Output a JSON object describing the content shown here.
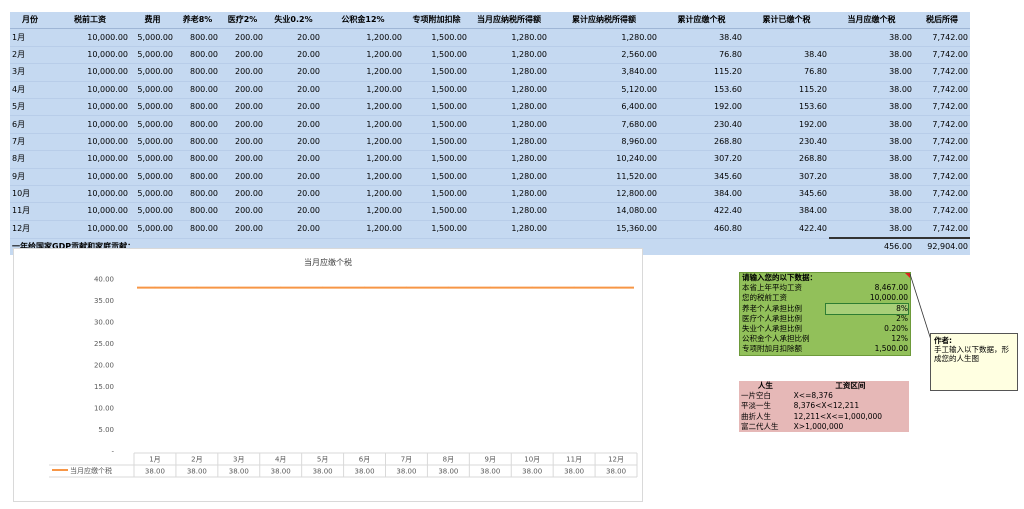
{
  "salary_table": {
    "headers": [
      "月份",
      "税前工资",
      "费用",
      "养老8%",
      "医疗2%",
      "失业0.2%",
      "公积金12%",
      "专项附加扣除",
      "当月应纳税所得额",
      "累计应纳税所得额",
      "累计应缴个税",
      "累计已缴个税",
      "当月应缴个税",
      "税后所得"
    ],
    "rows": [
      [
        "1月",
        "10,000.00",
        "5,000.00",
        "800.00",
        "200.00",
        "20.00",
        "1,200.00",
        "1,500.00",
        "1,280.00",
        "1,280.00",
        "38.40",
        "",
        "38.00",
        "7,742.00"
      ],
      [
        "2月",
        "10,000.00",
        "5,000.00",
        "800.00",
        "200.00",
        "20.00",
        "1,200.00",
        "1,500.00",
        "1,280.00",
        "2,560.00",
        "76.80",
        "38.40",
        "38.00",
        "7,742.00"
      ],
      [
        "3月",
        "10,000.00",
        "5,000.00",
        "800.00",
        "200.00",
        "20.00",
        "1,200.00",
        "1,500.00",
        "1,280.00",
        "3,840.00",
        "115.20",
        "76.80",
        "38.00",
        "7,742.00"
      ],
      [
        "4月",
        "10,000.00",
        "5,000.00",
        "800.00",
        "200.00",
        "20.00",
        "1,200.00",
        "1,500.00",
        "1,280.00",
        "5,120.00",
        "153.60",
        "115.20",
        "38.00",
        "7,742.00"
      ],
      [
        "5月",
        "10,000.00",
        "5,000.00",
        "800.00",
        "200.00",
        "20.00",
        "1,200.00",
        "1,500.00",
        "1,280.00",
        "6,400.00",
        "192.00",
        "153.60",
        "38.00",
        "7,742.00"
      ],
      [
        "6月",
        "10,000.00",
        "5,000.00",
        "800.00",
        "200.00",
        "20.00",
        "1,200.00",
        "1,500.00",
        "1,280.00",
        "7,680.00",
        "230.40",
        "192.00",
        "38.00",
        "7,742.00"
      ],
      [
        "7月",
        "10,000.00",
        "5,000.00",
        "800.00",
        "200.00",
        "20.00",
        "1,200.00",
        "1,500.00",
        "1,280.00",
        "8,960.00",
        "268.80",
        "230.40",
        "38.00",
        "7,742.00"
      ],
      [
        "8月",
        "10,000.00",
        "5,000.00",
        "800.00",
        "200.00",
        "20.00",
        "1,200.00",
        "1,500.00",
        "1,280.00",
        "10,240.00",
        "307.20",
        "268.80",
        "38.00",
        "7,742.00"
      ],
      [
        "9月",
        "10,000.00",
        "5,000.00",
        "800.00",
        "200.00",
        "20.00",
        "1,200.00",
        "1,500.00",
        "1,280.00",
        "11,520.00",
        "345.60",
        "307.20",
        "38.00",
        "7,742.00"
      ],
      [
        "10月",
        "10,000.00",
        "5,000.00",
        "800.00",
        "200.00",
        "20.00",
        "1,200.00",
        "1,500.00",
        "1,280.00",
        "12,800.00",
        "384.00",
        "345.60",
        "38.00",
        "7,742.00"
      ],
      [
        "11月",
        "10,000.00",
        "5,000.00",
        "800.00",
        "200.00",
        "20.00",
        "1,200.00",
        "1,500.00",
        "1,280.00",
        "14,080.00",
        "422.40",
        "384.00",
        "38.00",
        "7,742.00"
      ],
      [
        "12月",
        "10,000.00",
        "5,000.00",
        "800.00",
        "200.00",
        "20.00",
        "1,200.00",
        "1,500.00",
        "1,280.00",
        "15,360.00",
        "460.80",
        "422.40",
        "38.00",
        "7,742.00"
      ]
    ],
    "summary_label": "一年给国家GDP贡献和家庭贡献：",
    "summary_tax_total": "456.00",
    "summary_net_total": "92,904.00"
  },
  "input_panel": {
    "title": "请输入您的以下数据：",
    "fields": [
      {
        "label": "本省上年平均工资",
        "value": "8,467.00"
      },
      {
        "label": "您的税前工资",
        "value": "10,000.00"
      },
      {
        "label": "养老个人承担比例",
        "value": "8%"
      },
      {
        "label": "医疗个人承担比例",
        "value": "2%"
      },
      {
        "label": "失业个人承担比例",
        "value": "0.20%"
      },
      {
        "label": "公积金个人承担比例",
        "value": "12%"
      },
      {
        "label": "专项附加月扣除额",
        "value": "1,500.00"
      }
    ]
  },
  "comment": {
    "author": "作者:",
    "text": "手工输入以下数据，形成您的人生图"
  },
  "life_table": {
    "headers": [
      "人生",
      "工资区间"
    ],
    "rows": [
      [
        "一片空白",
        "X<=8,376"
      ],
      [
        "平淡一生",
        "8,376<X<12,211"
      ],
      [
        "曲折人生",
        "12,211<X<=1,000,000"
      ],
      [
        "富二代人生",
        "X>1,000,000"
      ]
    ]
  },
  "chart_data": {
    "type": "line",
    "title": "当月应缴个税",
    "categories": [
      "1月",
      "2月",
      "3月",
      "4月",
      "5月",
      "6月",
      "7月",
      "8月",
      "9月",
      "10月",
      "11月",
      "12月"
    ],
    "series": [
      {
        "name": "当月应缴个税",
        "values": [
          38,
          38,
          38,
          38,
          38,
          38,
          38,
          38,
          38,
          38,
          38,
          38
        ],
        "color": "#f79646"
      }
    ],
    "value_labels": [
      "38.00",
      "38.00",
      "38.00",
      "38.00",
      "38.00",
      "38.00",
      "38.00",
      "38.00",
      "38.00",
      "38.00",
      "38.00",
      "38.00"
    ],
    "y_ticks": [
      "40.00",
      "35.00",
      "30.00",
      "25.00",
      "20.00",
      "15.00",
      "10.00",
      "5.00",
      "-"
    ],
    "ylim": [
      0,
      40
    ],
    "legend": "data-table-bottom",
    "grid": false
  },
  "colors": {
    "table_bg": "#c5d9f1",
    "input_bg": "#92c05a",
    "life_bg": "#e6b8b7",
    "comment_bg": "#ffffe1",
    "series_line": "#f79646"
  }
}
